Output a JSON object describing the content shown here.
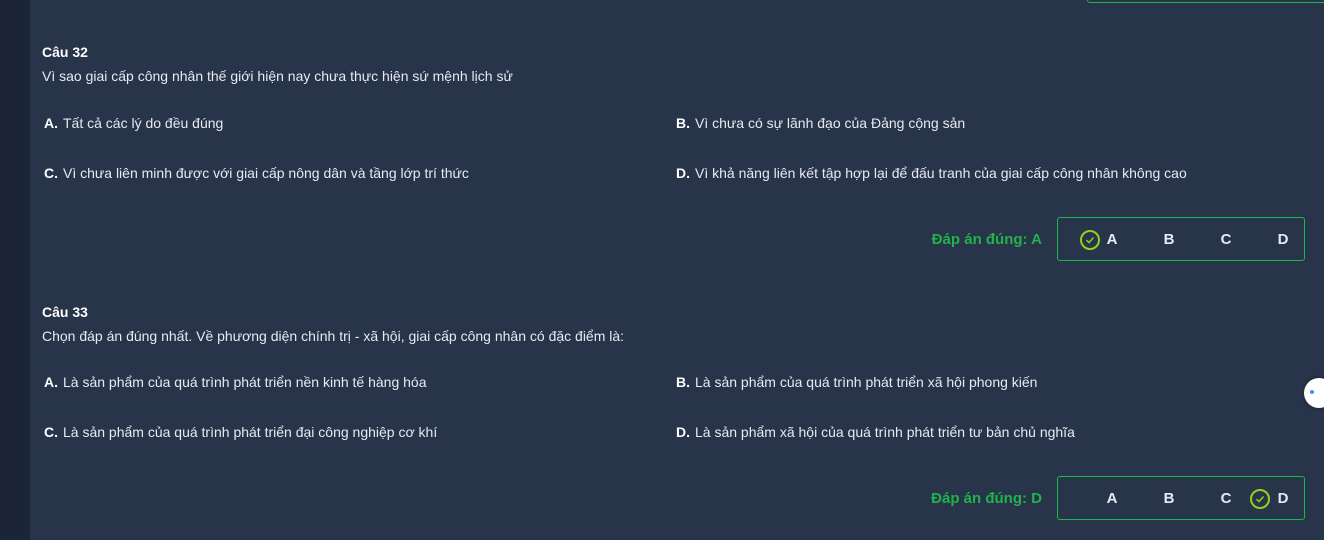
{
  "q32": {
    "title": "Câu 32",
    "text": "Vì sao giai cấp công nhân thế giới hiện nay chưa thực hiện sứ mệnh lịch sử",
    "options": [
      {
        "letter": "A.",
        "text": "Tất cả các lý do đều đúng"
      },
      {
        "letter": "B.",
        "text": "Vì chưa có sự lãnh đạo của Đảng cộng sản"
      },
      {
        "letter": "C.",
        "text": "Vì chưa liên minh được với giai cấp nông dân và tầng lớp trí thức"
      },
      {
        "letter": "D.",
        "text": "Vì khả năng liên kết tập hợp lại để đấu tranh của giai cấp công nhân không cao"
      }
    ],
    "correct_label": "Đáp án đúng: A",
    "choices": [
      "A",
      "B",
      "C",
      "D"
    ],
    "selected": "A"
  },
  "q33": {
    "title": "Câu 33",
    "text": "Chọn đáp án đúng nhất. Về phương diện chính trị - xã hội, giai cấp công nhân có đặc điểm là:",
    "options": [
      {
        "letter": "A.",
        "text": "Là sản phẩm của quá trình phát triển nền kinh tế hàng hóa"
      },
      {
        "letter": "B.",
        "text": "Là sản phẩm của quá trình phát triển xã hội phong kiến"
      },
      {
        "letter": "C.",
        "text": "Là sản phẩm của quá trình phát triển đại công nghiệp cơ khí"
      },
      {
        "letter": "D.",
        "text": "Là sản phẩm xã hội của quá trình phát triển tư bản chủ nghĩa"
      }
    ],
    "correct_label": "Đáp án đúng: D",
    "choices": [
      "A",
      "B",
      "C",
      "D"
    ],
    "selected": "D"
  },
  "colors": {
    "background": "#202a3d",
    "panel": "#283449",
    "correct": "#22b14c",
    "check": "#8fd11e"
  }
}
